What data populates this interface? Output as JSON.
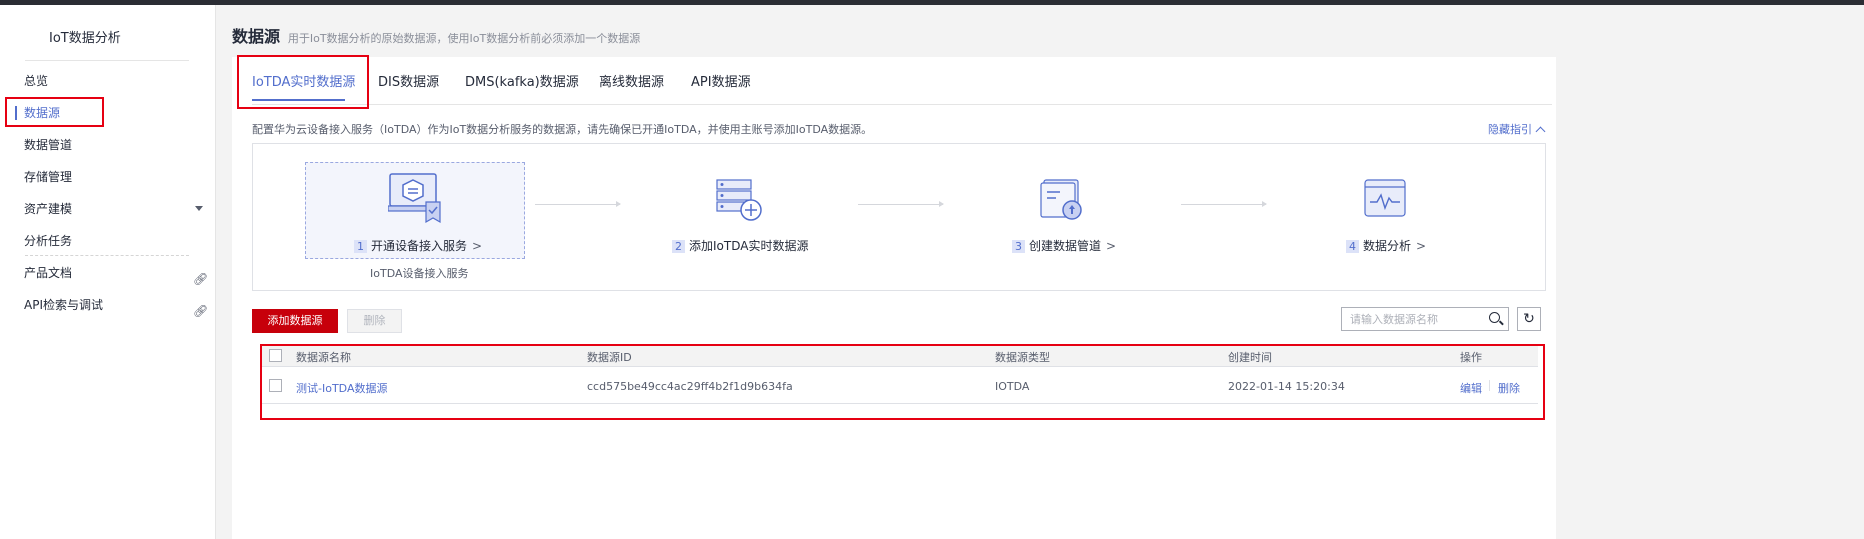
{
  "sidebar": {
    "title": "IoT数据分析",
    "items": [
      {
        "label": "总览"
      },
      {
        "label": "数据源"
      },
      {
        "label": "数据管道"
      },
      {
        "label": "存储管理"
      },
      {
        "label": "资产建模"
      },
      {
        "label": "分析任务"
      },
      {
        "label": "产品文档"
      },
      {
        "label": "API检索与调试"
      }
    ]
  },
  "page": {
    "title": "数据源",
    "subtitle": "用于IoT数据分析的原始数据源，使用IoT数据分析前必须添加一个数据源"
  },
  "tabs": [
    {
      "label": "IoTDA实时数据源"
    },
    {
      "label": "DIS数据源"
    },
    {
      "label": "DMS(kafka)数据源"
    },
    {
      "label": "离线数据源"
    },
    {
      "label": "API数据源"
    }
  ],
  "guide": {
    "description": "配置华为云设备接入服务（IoTDA）作为IoT数据分析服务的数据源，请先确保已开通IoTDA，并使用主账号添加IoTDA数据源。",
    "hide_label": "隐藏指引",
    "steps": [
      {
        "num": "1",
        "label": "开通设备接入服务",
        "sub": "IoTDA设备接入服务",
        "icon": "device-access-icon"
      },
      {
        "num": "2",
        "label": "添加IoTDA实时数据源",
        "icon": "add-datasource-icon"
      },
      {
        "num": "3",
        "label": "创建数据管道",
        "icon": "create-pipeline-icon"
      },
      {
        "num": "4",
        "label": "数据分析",
        "icon": "analysis-icon"
      }
    ]
  },
  "toolbar": {
    "add_label": "添加数据源",
    "delete_label": "删除",
    "search_placeholder": "请输入数据源名称"
  },
  "table": {
    "headers": [
      "数据源名称",
      "数据源ID",
      "数据源类型",
      "创建时间",
      "操作"
    ],
    "rows": [
      {
        "name": "测试-IoTDA数据源",
        "id": "ccd575be49cc4ac29ff4b2f1d9b634fa",
        "type": "IOTDA",
        "created": "2022-01-14 15:20:34",
        "edit": "编辑",
        "delete": "删除"
      }
    ]
  },
  "colors": {
    "accent": "#526ecc",
    "primary_button": "#c7000b",
    "highlight_box": "#e60012"
  }
}
